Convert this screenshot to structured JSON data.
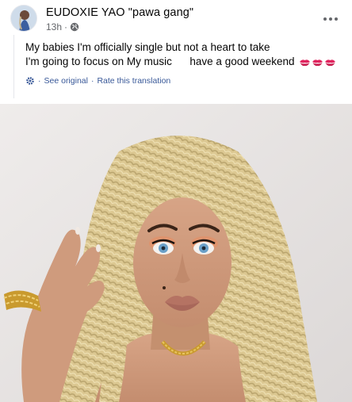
{
  "post": {
    "author_name": "EUDOXIE YAO \"pawa gang\"",
    "timestamp": "13h",
    "privacy_icon": "globe-icon",
    "more_icon": "more-horizontal-icon",
    "caption_lines": [
      "My babies I'm officially single but not a heart to take",
      "I'm going to focus on My music      have a good weekend"
    ],
    "caption_emoji": "kiss-mark-icon",
    "translation": {
      "icon": "gear-icon",
      "see_original": "See original",
      "separator": "·",
      "rate": "Rate this translation"
    },
    "photo": {
      "icon": "portrait-photo"
    }
  },
  "colors": {
    "text": "#050505",
    "secondary": "#65676b",
    "link": "#385898",
    "kiss": "#e0245e",
    "braids": "#d9c58e",
    "background_wall": "#e7e4e2"
  }
}
